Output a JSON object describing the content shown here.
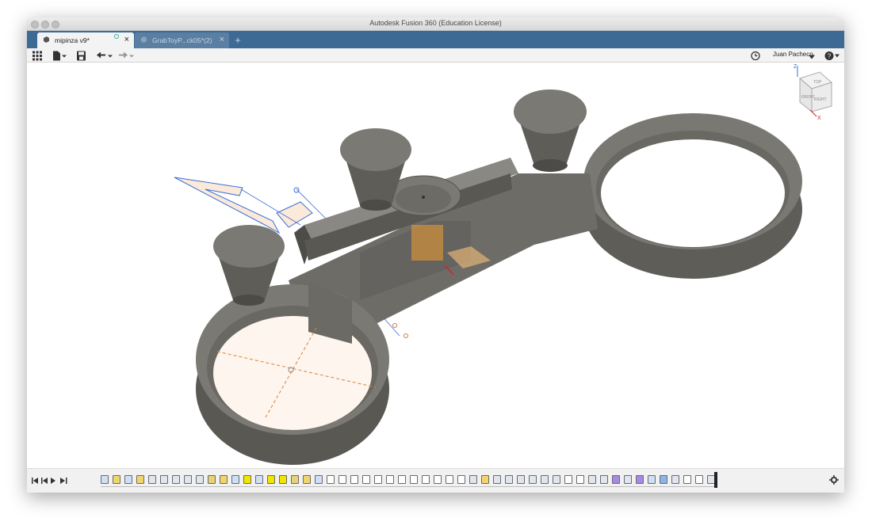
{
  "window": {
    "title": "Autodesk Fusion 360 (Education License)"
  },
  "tabs": [
    {
      "label": "mipinza v9*",
      "active": true
    },
    {
      "label": "GrabToyP...ck05*(2)",
      "active": false
    }
  ],
  "toolbar": {
    "user_name": "Juan Pacheco"
  },
  "viewcube": {
    "top": "TOP",
    "front": "FRONT",
    "right": "RIGHT",
    "z": "Z",
    "x": "X"
  },
  "colors": {
    "tabbar": "#3d6a94",
    "model": "#62605b",
    "sketch": "#3a6fd8",
    "selection": "#f0a030",
    "timeline_highlight": "#f2e600"
  },
  "icons": [
    "grid-icon",
    "file-icon",
    "save-icon",
    "undo-icon",
    "redo-icon",
    "clock-icon",
    "help-icon",
    "gear-icon"
  ]
}
